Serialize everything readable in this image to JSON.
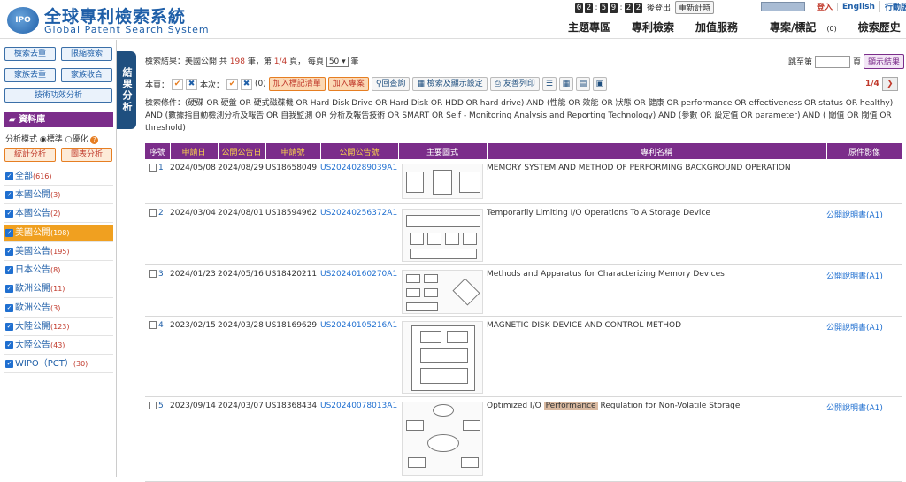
{
  "header": {
    "logo_mark": "IPO",
    "logo_zh": "全球專利檢索系統",
    "logo_en": "Global Patent Search System",
    "timer_digits": [
      "0",
      "2",
      "5",
      "9",
      "2",
      "2"
    ],
    "logout": "後登出",
    "reset_timer": "重新計時",
    "login": "登入",
    "english": "English",
    "mobile": "行動版",
    "nav": [
      "主題專區",
      "專利檢索",
      "加值服務",
      "專案/標記",
      "檢索歷史",
      "登出"
    ],
    "nav_badge": "(0)"
  },
  "sidebar": {
    "buttons": [
      "檢索去重",
      "限縮檢索",
      "家族去重",
      "家族收合",
      "技術功效分析"
    ],
    "vtab": "結果分析",
    "panel_title": "資料庫",
    "mode_label": "分析模式",
    "mode_standard": "標準",
    "mode_optimized": "優化",
    "stat_btn": "統計分析",
    "chart_btn": "圖表分析",
    "categories": [
      {
        "label": "全部",
        "count": "(616)"
      },
      {
        "label": "本國公開",
        "count": "(3)"
      },
      {
        "label": "本國公告",
        "count": "(2)"
      },
      {
        "label": "美國公開",
        "count": "(198)"
      },
      {
        "label": "美國公告",
        "count": "(195)"
      },
      {
        "label": "日本公告",
        "count": "(8)"
      },
      {
        "label": "歐洲公開",
        "count": "(11)"
      },
      {
        "label": "歐洲公告",
        "count": "(3)"
      },
      {
        "label": "大陸公開",
        "count": "(123)"
      },
      {
        "label": "大陸公告",
        "count": "(43)"
      },
      {
        "label": "WIPO（PCT）",
        "count": "(30)"
      }
    ]
  },
  "results": {
    "prefix": "檢索結果：美國公開 共",
    "total": "198",
    "mid1": "筆，第",
    "page": "1/4",
    "mid2": "頁， 每頁",
    "per_page": "50",
    "suffix": "筆",
    "goto_label": "跳至第",
    "goto_suffix": "頁",
    "goto_btn": "顯示結果",
    "this_page": "本頁：",
    "this_time": "本次：",
    "count_zero": "(0)",
    "add_mark": "加入標記清單",
    "add_project": "加入專案",
    "review": "回查詢",
    "search_settings": "檢索及顯示設定",
    "print": "友善列印",
    "page_indicator": "1/4",
    "condition": "檢索條件：(硬碟 OR 硬盤 OR 硬式磁碟機 OR Hard Disk Drive OR Hard Disk OR HDD OR hard drive) AND (性能 OR 效能 OR 狀態 OR 健康 OR performance OR effectiveness OR status OR healthy) AND (數據指自動檢測分析及報告 OR 自我監測 OR 分析及報告技術 OR SMART OR Self - Monitoring Analysis and Reporting Technology) AND (參數 OR 設定值 OR parameter) AND ( 閾值 OR 閥值 OR threshold)"
  },
  "table": {
    "headers": [
      "序號",
      "申請日",
      "公開公告日",
      "申請號",
      "公開公告號",
      "主要圖式",
      "專利名稱",
      "原件影像"
    ],
    "rows": [
      {
        "seq": "1",
        "app_date": "2024/05/08",
        "pub_date": "2024/08/29",
        "app_no": "US18658049",
        "pub_no": "US20240289039A1",
        "title": "MEMORY SYSTEM AND METHOD OF PERFORMING BACKGROUND OPERATION",
        "doc": ""
      },
      {
        "seq": "2",
        "app_date": "2024/03/04",
        "pub_date": "2024/08/01",
        "app_no": "US18594962",
        "pub_no": "US20240256372A1",
        "title": "Temporarily Limiting I/O Operations To A Storage Device",
        "doc": "公開說明書(A1)"
      },
      {
        "seq": "3",
        "app_date": "2024/01/23",
        "pub_date": "2024/05/16",
        "app_no": "US18420211",
        "pub_no": "US20240160270A1",
        "title": "Methods and Apparatus for Characterizing Memory Devices",
        "doc": "公開說明書(A1)"
      },
      {
        "seq": "4",
        "app_date": "2023/02/15",
        "pub_date": "2024/03/28",
        "app_no": "US18169629",
        "pub_no": "US20240105216A1",
        "title": "MAGNETIC DISK DEVICE AND CONTROL METHOD",
        "doc": "公開說明書(A1)"
      },
      {
        "seq": "5",
        "app_date": "2023/09/14",
        "pub_date": "2024/03/07",
        "app_no": "US18368434",
        "pub_no": "US20240078013A1",
        "title_pre": "Optimized I/O ",
        "title_hl": "Performance",
        "title_post": " Regulation for Non-Volatile Storage",
        "doc": "公開說明書(A1)"
      }
    ]
  }
}
